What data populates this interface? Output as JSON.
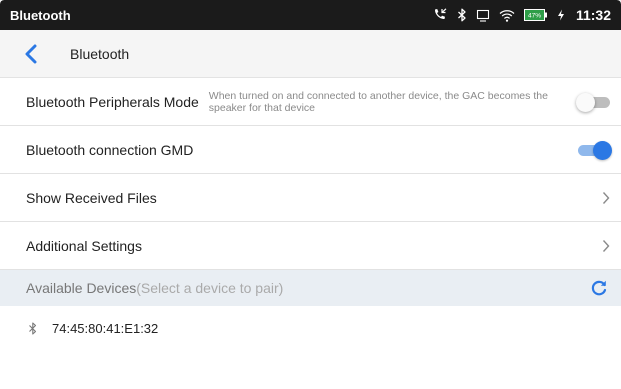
{
  "status_bar": {
    "title": "Bluetooth",
    "time": "11:32",
    "battery_level": "47%",
    "icons": [
      "phone-call-icon",
      "bluetooth-icon",
      "screen-cast-icon",
      "wifi-icon",
      "battery-icon",
      "charging-icon"
    ]
  },
  "header": {
    "title": "Bluetooth",
    "back_icon": "chevron-left-icon"
  },
  "settings": {
    "peripherals_mode": {
      "label": "Bluetooth Peripherals Mode",
      "description": "When turned on and connected to another device, the GAC becomes the speaker for that device",
      "enabled": false
    },
    "connection_gmd": {
      "label": "Bluetooth connection GMD",
      "enabled": true
    },
    "received_files": {
      "label": "Show Received Files"
    },
    "additional_settings": {
      "label": "Additional Settings"
    }
  },
  "available_devices": {
    "title": "Available Devices",
    "hint": "(Select a device to pair)",
    "refresh_icon": "refresh-icon",
    "devices": [
      {
        "name": "74:45:80:41:E1:32",
        "icon": "bluetooth-icon"
      }
    ]
  },
  "colors": {
    "accent": "#2b78e4",
    "status_bar": "#1b1b1b",
    "section_bg": "#e9eef3"
  }
}
